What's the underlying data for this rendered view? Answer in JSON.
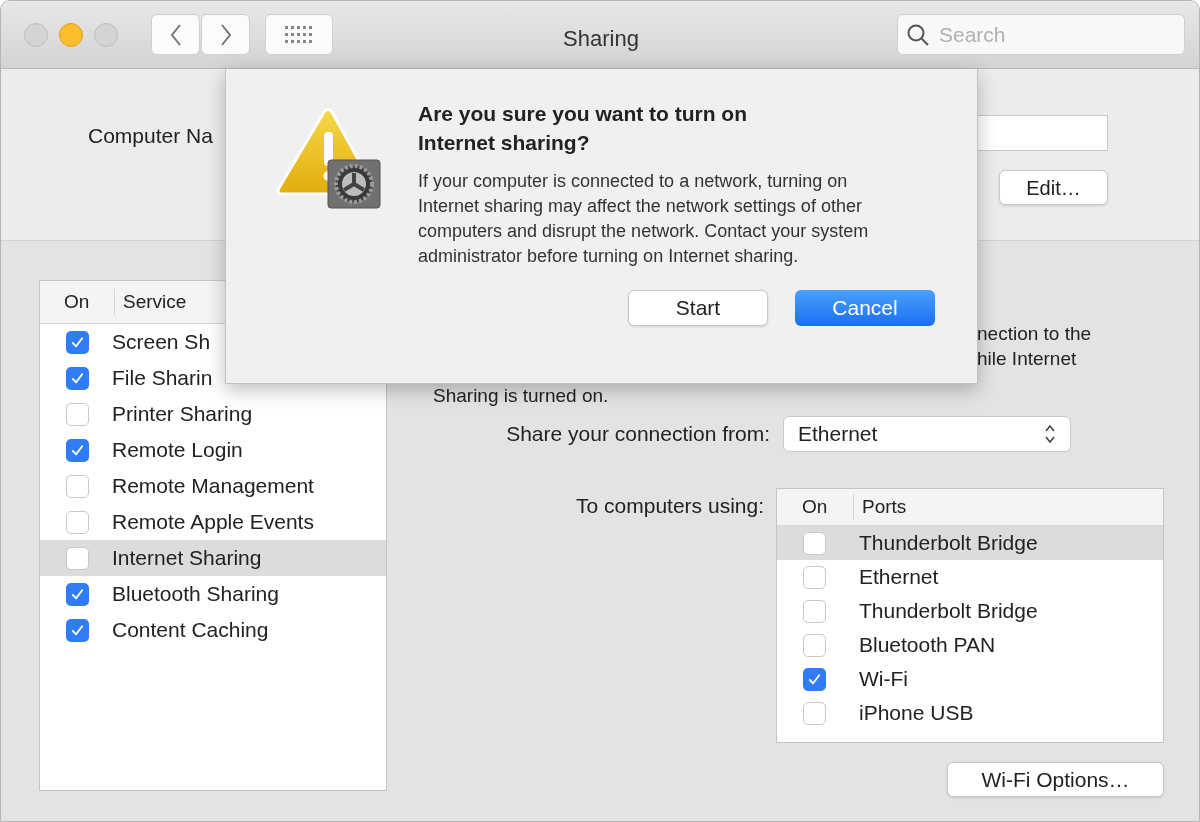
{
  "window": {
    "title": "Sharing"
  },
  "toolbar": {
    "search": {
      "placeholder": "Search"
    }
  },
  "computer_name": {
    "label": "Computer Na",
    "edit_button": "Edit…"
  },
  "services": {
    "columns": [
      "On",
      "Service"
    ],
    "rows": [
      {
        "name": "Screen Sh",
        "checked": true,
        "selected": false
      },
      {
        "name": "File Sharin",
        "checked": true,
        "selected": false
      },
      {
        "name": "Printer Sharing",
        "checked": false,
        "selected": false
      },
      {
        "name": "Remote Login",
        "checked": true,
        "selected": false
      },
      {
        "name": "Remote Management",
        "checked": false,
        "selected": false
      },
      {
        "name": "Remote Apple Events",
        "checked": false,
        "selected": false
      },
      {
        "name": "Internet Sharing",
        "checked": false,
        "selected": true
      },
      {
        "name": "Bluetooth Sharing",
        "checked": true,
        "selected": false
      },
      {
        "name": "Content Caching",
        "checked": true,
        "selected": false
      }
    ]
  },
  "internet_sharing": {
    "description_lines": [
      "nection to the",
      "hile Internet"
    ],
    "description_end": "Sharing is turned on.",
    "share_from": {
      "label": "Share your connection from:",
      "value": "Ethernet"
    },
    "to_computers": {
      "label": "To computers using:",
      "columns": [
        "On",
        "Ports"
      ],
      "rows": [
        {
          "name": "Thunderbolt Bridge",
          "checked": false,
          "selected": true
        },
        {
          "name": "Ethernet",
          "checked": false,
          "selected": false
        },
        {
          "name": "Thunderbolt Bridge",
          "checked": false,
          "selected": false
        },
        {
          "name": "Bluetooth PAN",
          "checked": false,
          "selected": false
        },
        {
          "name": "Wi-Fi",
          "checked": true,
          "selected": false
        },
        {
          "name": "iPhone USB",
          "checked": false,
          "selected": false
        }
      ]
    },
    "wifi_options_button": "Wi-Fi Options…"
  },
  "alert": {
    "title": "Are you sure you want to turn on Internet sharing?",
    "message": "If your computer is connected to a network, turning on Internet sharing may affect the network settings of other computers and disrupt the network. Contact your system administrator before turning on Internet sharing.",
    "buttons": [
      {
        "label": "Start",
        "default": false
      },
      {
        "label": "Cancel",
        "default": true
      }
    ]
  }
}
